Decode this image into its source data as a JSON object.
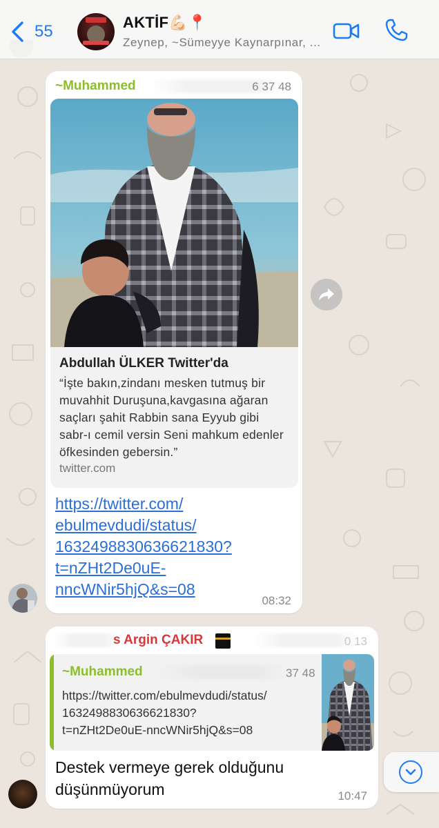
{
  "header": {
    "back_count": "55",
    "group_title": "AKTİF💪🏻📍",
    "group_members": "Zeynep, ~Sümeyye Kaynarpınar, ..."
  },
  "messages": [
    {
      "sender": "~Muhammed",
      "sender_time_fragment": "6 37 48",
      "link_preview": {
        "title": "Abdullah ÜLKER Twitter'da",
        "description": "“İşte bakın,zindanı mesken tutmuş bir muvahhit Duruşuna,kavgasına ağaran saçları şahit Rabbin sana Eyyub gibi sabr-ı cemil versin Seni mahkum edenler öfkesinden gebersin.”",
        "domain": "twitter.com"
      },
      "link_lines": [
        "https://twitter.com/",
        "ebulmevdudi/status/",
        "1632498830636621830?",
        "t=nZHt2De0uE-",
        "nncWNir5hjQ&s=08"
      ],
      "time": "08:32"
    },
    {
      "sender": "Argin ÇAKIR",
      "sender_prefix_fragment": "s",
      "sender_time_fragment": "0 13",
      "quote": {
        "sender": "~Muhammed",
        "time_fragment": "37 48",
        "text_lines": [
          "https://twitter.com/ebulmevdudi/status/",
          "1632498830636621830?",
          "t=nZHt2De0uE-nncWNir5hjQ&s=08"
        ]
      },
      "text_lines": [
        "Destek vermeye gerek olduğunu",
        "düşünmüyorum"
      ],
      "time": "10:47"
    }
  ],
  "colors": {
    "accent": "#1a7cf5",
    "sender_green": "#8dbd2d",
    "sender_red": "#d8373b",
    "link": "#2b6ed6",
    "wallpaper": "#ebe5de"
  },
  "icons": [
    "chevron-left-icon",
    "video-call-icon",
    "phone-icon",
    "forward-icon",
    "chevron-down-icon",
    "kaaba-emoji"
  ]
}
